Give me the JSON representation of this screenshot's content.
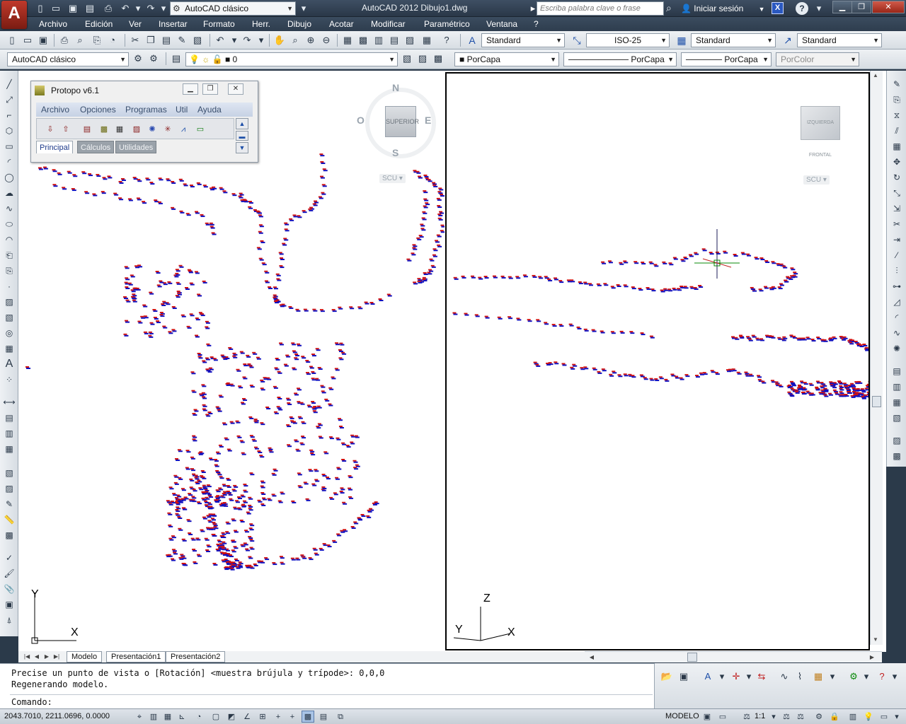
{
  "titlebar": {
    "logo_letter": "A",
    "workspace": "AutoCAD clásico",
    "title": "AutoCAD 2012    Dibujo1.dwg",
    "search_placeholder": "Escriba palabra clave o frase",
    "login": "Iniciar sesión",
    "exchange_letter": "X",
    "help": "?"
  },
  "menu": [
    "Archivo",
    "Edición",
    "Ver",
    "Insertar",
    "Formato",
    "Herr.",
    "Dibujo",
    "Acotar",
    "Modificar",
    "Paramétrico",
    "Ventana",
    "?"
  ],
  "toolbar1": {
    "text_style": "Standard",
    "dim_style": "ISO-25",
    "table_style": "Standard",
    "mleader_style": "Standard"
  },
  "toolbar2": {
    "workspace": "AutoCAD clásico",
    "layer": "0",
    "color": "PorCapa",
    "linetype": "PorCapa",
    "lineweight": "PorCapa",
    "plotstyle": "PorColor"
  },
  "viewport_left": {
    "compass": {
      "north": "N",
      "south": "S",
      "east": "E",
      "west": "O"
    },
    "cube_face": "SUPERIOR",
    "ucs": "SCU ▾",
    "axis_y": "Y",
    "axis_x": "X"
  },
  "viewport_right": {
    "cube_face": "IZQUIERDA  FRONTAL",
    "ucs": "SCU ▾",
    "axis_z": "Z",
    "axis_y": "Y",
    "axis_x": "X"
  },
  "protopo": {
    "title": "Protopo v6.1",
    "menu": [
      "Archivo",
      "Opciones",
      "Programas",
      "Util",
      "Ayuda"
    ],
    "tabs": [
      "Principal",
      "Cálculos",
      "Utilidades"
    ]
  },
  "layout_tabs": [
    "Modelo",
    "Presentación1",
    "Presentación2"
  ],
  "command": {
    "history1": "Precise un punto de vista o [Rotación] <muestra brújula y trípode>: 0,0,0",
    "history2": "Regenerando modelo.",
    "prompt": "Comando:"
  },
  "status": {
    "coords": "2043.7010, 2211.0696, 0.0000",
    "model": "MODELO",
    "scale": "1:1"
  },
  "colors": {
    "point_red": "#d01010",
    "point_blue": "#1010c0",
    "title_bg": "#2e3d4e"
  }
}
